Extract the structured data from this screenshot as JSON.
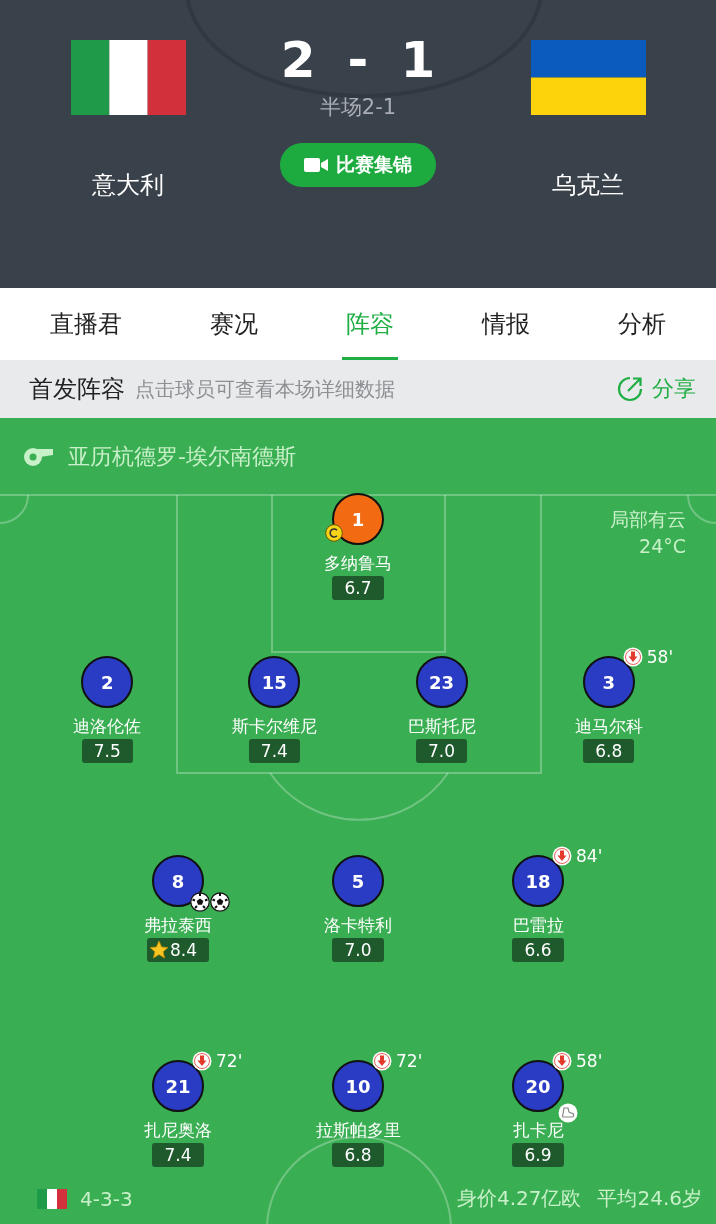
{
  "header": {
    "home": {
      "name": "意大利",
      "flag": {
        "kind": "italy"
      }
    },
    "away": {
      "name": "乌克兰",
      "flag": {
        "kind": "ukraine"
      }
    },
    "home_score": "2",
    "separator": "-",
    "away_score": "1",
    "half_time": "半场2-1",
    "highlights_button": "比赛集锦"
  },
  "tabs": [
    {
      "label": "直播君",
      "selected": false
    },
    {
      "label": "赛况",
      "selected": false
    },
    {
      "label": "阵容",
      "selected": true
    },
    {
      "label": "情报",
      "selected": false
    },
    {
      "label": "分析",
      "selected": false
    }
  ],
  "lineup_bar": {
    "title": "首发阵容",
    "hint": "点击球员可查看本场详细数据",
    "share": "分享"
  },
  "pitch": {
    "referee": "亚历杭德罗-埃尔南德斯",
    "weather": "局部有云",
    "temperature": "24°C",
    "lines": [
      {
        "players": [
          {
            "number": "1",
            "name": "多纳鲁马",
            "rating": "6.7",
            "kind": "goalkeeper",
            "captain": true,
            "mvp": false
          }
        ]
      },
      {
        "players": [
          {
            "number": "2",
            "name": "迪洛伦佐",
            "rating": "7.5",
            "kind": "outfield",
            "captain": false,
            "mvp": false
          },
          {
            "number": "15",
            "name": "斯卡尔维尼",
            "rating": "7.4",
            "kind": "outfield",
            "captain": false,
            "mvp": false
          },
          {
            "number": "23",
            "name": "巴斯托尼",
            "rating": "7.0",
            "kind": "outfield",
            "captain": false,
            "mvp": false
          },
          {
            "number": "3",
            "name": "迪马尔科",
            "rating": "6.8",
            "kind": "outfield",
            "captain": false,
            "mvp": false,
            "events": [
              {
                "kind": "sub_out",
                "minute": "58'"
              }
            ]
          }
        ]
      },
      {
        "players": [
          {
            "number": "8",
            "name": "弗拉泰西",
            "rating": "8.4",
            "kind": "outfield",
            "captain": false,
            "mvp": true,
            "events": [
              {
                "kind": "goal"
              },
              {
                "kind": "goal"
              }
            ]
          },
          {
            "number": "5",
            "name": "洛卡特利",
            "rating": "7.0",
            "kind": "outfield",
            "captain": false,
            "mvp": false
          },
          {
            "number": "18",
            "name": "巴雷拉",
            "rating": "6.6",
            "kind": "outfield",
            "captain": false,
            "mvp": false,
            "events": [
              {
                "kind": "sub_out",
                "minute": "84'"
              }
            ]
          }
        ]
      },
      {
        "players": [
          {
            "number": "21",
            "name": "扎尼奥洛",
            "rating": "7.4",
            "kind": "outfield",
            "captain": false,
            "mvp": false,
            "events": [
              {
                "kind": "sub_out",
                "minute": "72'"
              }
            ]
          },
          {
            "number": "10",
            "name": "拉斯帕多里",
            "rating": "6.8",
            "kind": "outfield",
            "captain": false,
            "mvp": false,
            "events": [
              {
                "kind": "sub_out",
                "minute": "72'"
              }
            ]
          },
          {
            "number": "20",
            "name": "扎卡尼",
            "rating": "6.9",
            "kind": "outfield",
            "captain": false,
            "mvp": false,
            "events": [
              {
                "kind": "sub_out",
                "minute": "58'"
              },
              {
                "kind": "assist"
              }
            ]
          }
        ]
      }
    ],
    "team_flag": {
      "kind": "italy"
    },
    "formation": "4-3-3",
    "market_value": "身价4.27亿欧",
    "average_age": "平均24.6岁"
  }
}
